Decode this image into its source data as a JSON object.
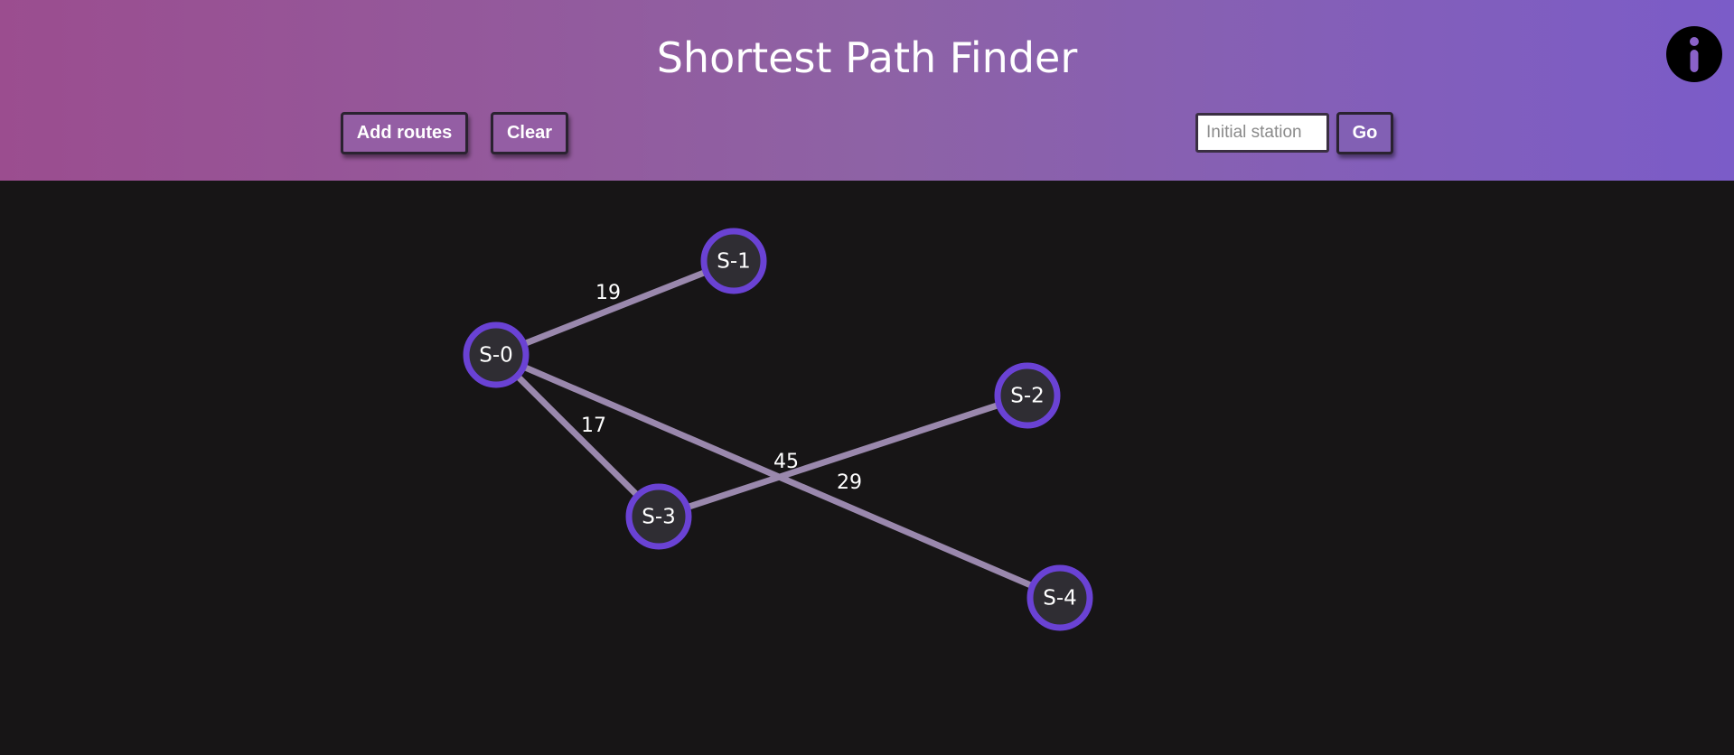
{
  "header": {
    "title": "Shortest Path Finder",
    "add_routes_label": "Add routes",
    "clear_label": "Clear",
    "station_placeholder": "Initial station",
    "station_value": "",
    "go_label": "Go",
    "info_icon": "info-icon"
  },
  "colors": {
    "header_gradient_start": "#9b4d8f",
    "header_gradient_end": "#7b5cc8",
    "canvas_background": "#171516",
    "node_fill": "#2f2d33",
    "node_stroke": "#6a42d4",
    "edge_color": "#9a88ad"
  },
  "graph": {
    "nodes": [
      {
        "id": "S-0",
        "label": "S-0"
      },
      {
        "id": "S-1",
        "label": "S-1"
      },
      {
        "id": "S-2",
        "label": "S-2"
      },
      {
        "id": "S-3",
        "label": "S-3"
      },
      {
        "id": "S-4",
        "label": "S-4"
      }
    ],
    "edges": [
      {
        "from": "S-0",
        "to": "S-1",
        "weight": "19"
      },
      {
        "from": "S-0",
        "to": "S-3",
        "weight": "17"
      },
      {
        "from": "S-3",
        "to": "S-2",
        "weight": "45"
      },
      {
        "from": "S-0",
        "to": "S-4",
        "weight": "29"
      }
    ]
  }
}
